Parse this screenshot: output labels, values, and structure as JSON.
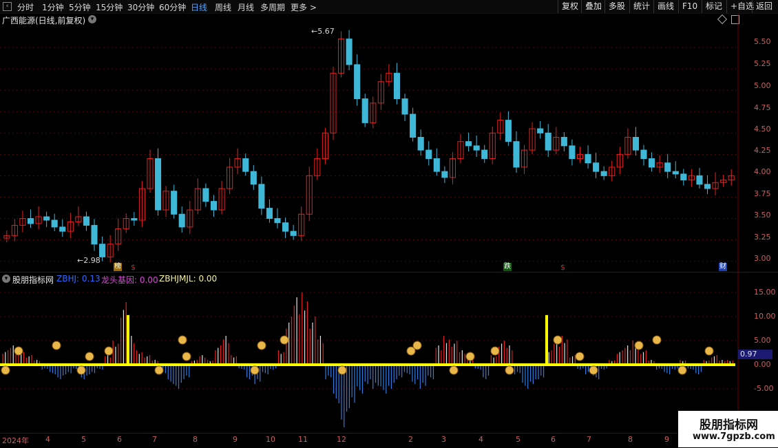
{
  "toolbar": {
    "periods": [
      "分时",
      "1分钟",
      "5分钟",
      "15分钟",
      "30分钟",
      "60分钟",
      "日线",
      "周线",
      "月线",
      "多周期",
      "更多 >"
    ],
    "active_period": "日线",
    "right_buttons": [
      "复权",
      "叠加",
      "多股",
      "统计",
      "画线",
      "F10",
      "标记",
      "+自选",
      "返回"
    ]
  },
  "main_chart": {
    "title": "广西能源(日线,前复权)",
    "high_label": "←5.67",
    "low_label": "←2.98",
    "y_ticks": [
      "5.50",
      "5.25",
      "5.00",
      "4.75",
      "4.50",
      "4.25",
      "4.00",
      "3.75",
      "3.50",
      "3.25",
      "3.00"
    ],
    "badges": {
      "bang": "榜",
      "die": "跌",
      "cai": "财",
      "dollar": "$"
    }
  },
  "indicator": {
    "name": "股朋指标网",
    "zbhj": "ZBHJ: 0.13",
    "gene": "龙头基因: 0.00",
    "jmjl": "ZBHJMJL: 0.00",
    "y_ticks": [
      "15.00",
      "10.00",
      "5.00",
      "0.00",
      "-5.00"
    ],
    "current_value": "0.97"
  },
  "x_axis": [
    "2024年",
    "4",
    "5",
    "6",
    "7",
    "8",
    "9",
    "10",
    "11",
    "12",
    "2",
    "3",
    "4",
    "5",
    "6",
    "7",
    "8",
    "9"
  ],
  "watermark": {
    "title": "股朋指标网",
    "url": "www.7gpzb.com"
  },
  "colors": {
    "up": "#e8201e",
    "down": "#3fb8d8",
    "yellow": "#ffff00",
    "hist_up": "#e8201e",
    "hist_down": "#2f7de0"
  },
  "chart_data": {
    "type": "candlestick",
    "closes": [
      3.3,
      3.42,
      3.5,
      3.44,
      3.52,
      3.48,
      3.4,
      3.35,
      3.46,
      3.52,
      3.42,
      3.2,
      3.05,
      3.2,
      3.38,
      3.5,
      3.48,
      3.85,
      4.2,
      3.6,
      3.82,
      3.55,
      3.4,
      3.6,
      3.85,
      3.7,
      3.6,
      3.85,
      4.1,
      4.2,
      4.05,
      3.9,
      3.62,
      3.5,
      3.45,
      3.35,
      3.3,
      3.55,
      4.0,
      4.2,
      4.5,
      5.2,
      5.6,
      5.3,
      4.9,
      4.62,
      4.85,
      5.1,
      5.2,
      4.9,
      4.72,
      4.45,
      4.3,
      4.2,
      4.05,
      3.98,
      4.2,
      4.4,
      4.35,
      4.3,
      4.2,
      4.5,
      4.65,
      4.4,
      4.1,
      4.3,
      4.55,
      4.5,
      4.3,
      4.45,
      4.35,
      4.2,
      4.25,
      4.15,
      4.05,
      4.0,
      4.1,
      4.25,
      4.45,
      4.3,
      4.2,
      4.1,
      4.15,
      4.05,
      4.02,
      3.95,
      4.0,
      3.9,
      3.85,
      3.92,
      3.95,
      4.0
    ],
    "histogram": [
      3,
      4,
      3,
      2,
      1,
      -1,
      -2,
      -3,
      -2,
      -1,
      -3,
      -2,
      -1,
      2,
      5,
      13,
      6,
      3,
      2,
      1,
      -2,
      -4,
      -5,
      -3,
      1,
      2,
      1,
      4,
      6,
      2,
      -1,
      -3,
      -4,
      -2,
      -1,
      3,
      10,
      14,
      15,
      10,
      6,
      -3,
      -8,
      -13,
      -9,
      -6,
      -4,
      -5,
      -6,
      -5,
      -3,
      -2,
      -4,
      -5,
      -3,
      4,
      6,
      5,
      3,
      2,
      -1,
      -3,
      2,
      5,
      4,
      -2,
      -5,
      -4,
      -3,
      3,
      5,
      6,
      2,
      -1,
      -2,
      -3,
      -1,
      1,
      3,
      4,
      5,
      3,
      1,
      -1,
      -2,
      -1,
      1,
      -1,
      -2,
      1,
      2,
      1,
      1
    ]
  }
}
